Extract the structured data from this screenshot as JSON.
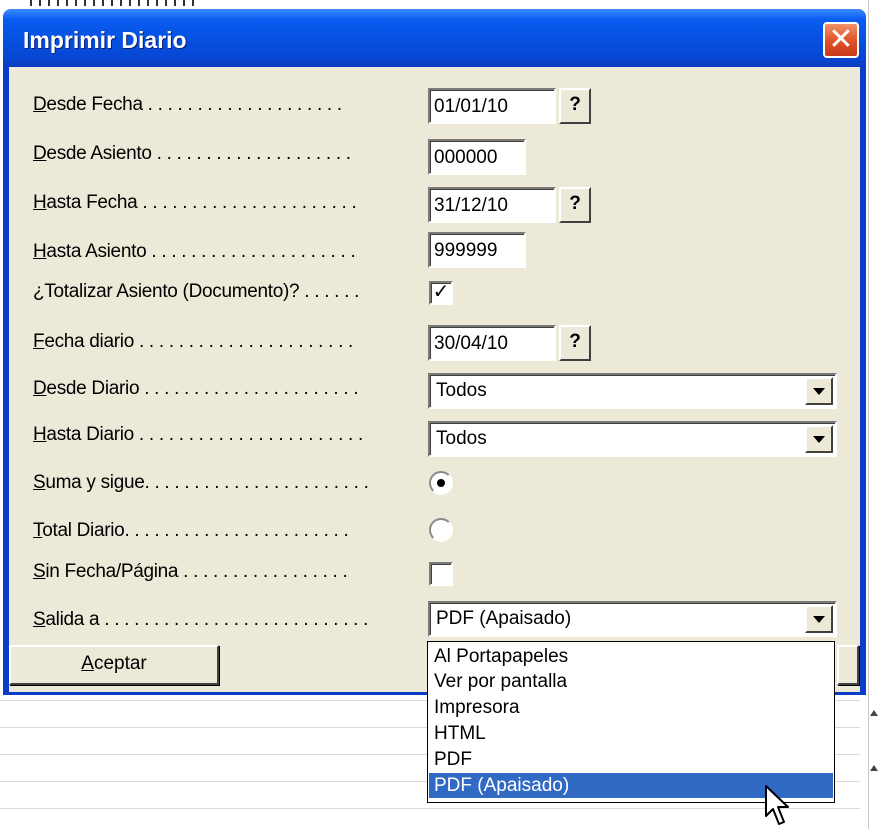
{
  "window": {
    "title": "Imprimir Diario",
    "close_glyph": "✕"
  },
  "form": {
    "desde_fecha": {
      "label_ul": "D",
      "label_rest": "esde Fecha . . . . . . . . . . . . . . . . . . . . ",
      "value": "01/01/10",
      "help": "?"
    },
    "desde_asiento": {
      "label_ul": "D",
      "label_rest": "esde Asiento . . . . . . . . . . . . . . . . . . . . ",
      "value": "000000"
    },
    "hasta_fecha": {
      "label_ul": "H",
      "label_rest": "asta Fecha . . . . . . . . . . . . . . . . . . . . . . ",
      "value": "31/12/10",
      "help": "?"
    },
    "hasta_asiento": {
      "label_ul": "H",
      "label_rest": "asta Asiento . . . . . . . . . . . . . . . . . . . . . ",
      "value": "999999"
    },
    "totalizar": {
      "label_ul": "¿",
      "label_rest": "Totalizar Asiento (Documento)? . . . . . . ",
      "checked_glyph": "✓"
    },
    "fecha_diario": {
      "label_ul": "F",
      "label_rest": "echa diario . . . . . . . . . . . . . . . . . . . . . . ",
      "value": "30/04/10",
      "help": "?"
    },
    "desde_diario": {
      "label_ul": "D",
      "label_rest": "esde Diario . . . . . . . . . . . . . . . . . . . . . . ",
      "value": "Todos"
    },
    "hasta_diario": {
      "label_ul": "H",
      "label_rest": "asta Diario . . . . . . . . . . . . . . . . . . . . . . . ",
      "value": "Todos"
    },
    "suma_y_sigue": {
      "label_ul": "S",
      "label_rest": "uma y sigue. . . . . . . . . . . . . . . . . . . . . . . "
    },
    "total_diario": {
      "label_ul": "T",
      "label_rest": "otal Diario. . . . . . . . . . . . . . . . . . . . . . . "
    },
    "sin_fecha": {
      "label_ul": "S",
      "label_rest": "in Fecha/Página . . . . . . . . . . . . . . . . . "
    },
    "salida": {
      "label_ul": "S",
      "label_rest": "alida a . . . . . . . . . . . . . . . . . . . . . . . . . . . ",
      "value": "PDF (Apaisado)"
    }
  },
  "buttons": {
    "aceptar_ul": "A",
    "aceptar_rest": "ceptar"
  },
  "dropdown": {
    "options": [
      "Al Portapapeles",
      "Ver por pantalla",
      "Impresora",
      "HTML",
      "PDF",
      "PDF (Apaisado)"
    ],
    "selected_index": 5
  },
  "colors": {
    "titlebar": "#0550e0",
    "dialog_bg": "#ece9d8",
    "selection": "#316ac5"
  }
}
